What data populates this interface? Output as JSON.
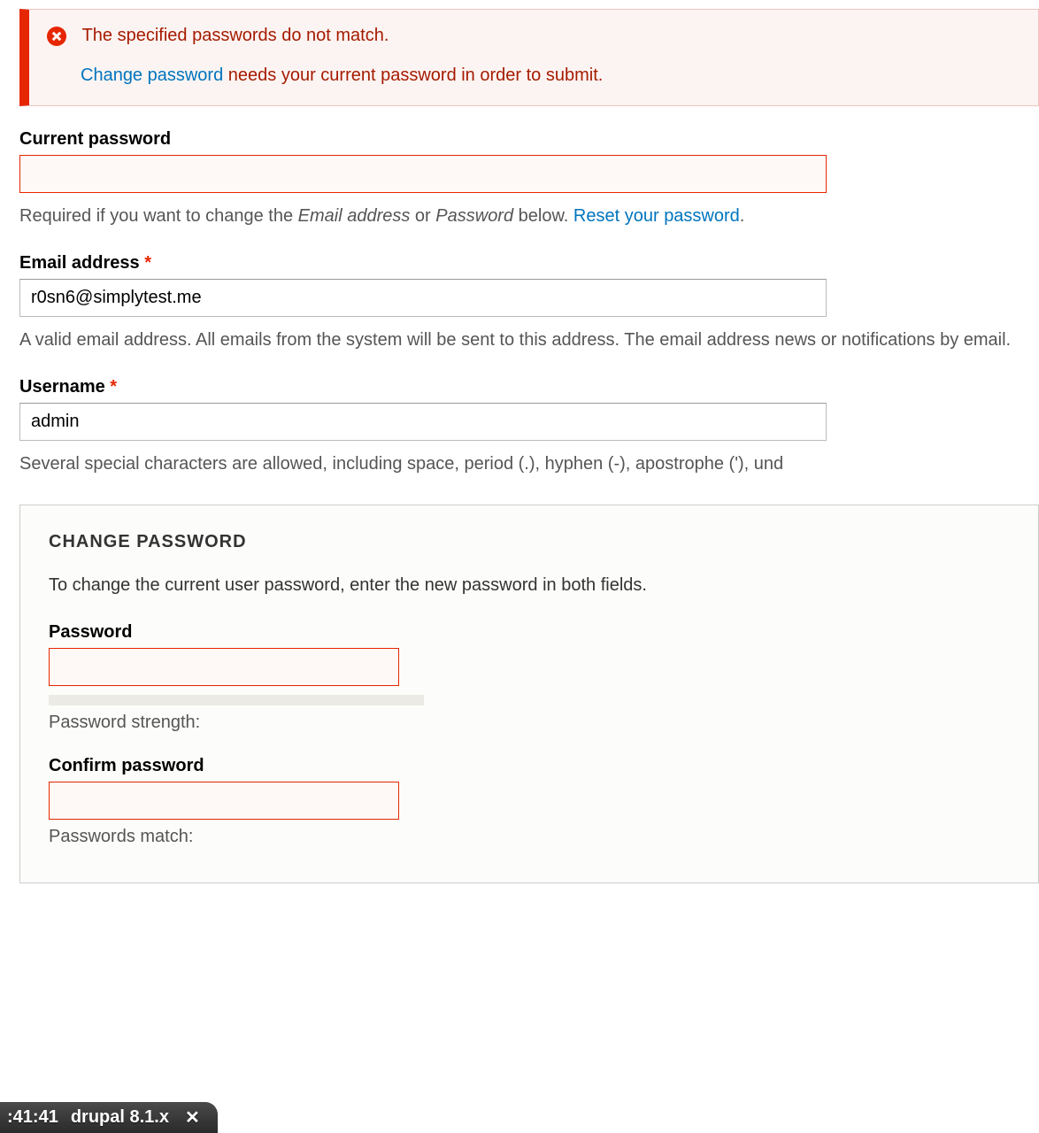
{
  "error": {
    "line1": "The specified passwords do not match.",
    "line2_link": "Change password",
    "line2_rest": " needs your current password in order to submit."
  },
  "form": {
    "current_password": {
      "label": "Current password",
      "value": "",
      "description_pre": "Required if you want to change the ",
      "em1": "Email address",
      "or": " or ",
      "em2": "Password",
      "description_post": " below. ",
      "reset_link": "Reset your password",
      "period": "."
    },
    "email": {
      "label": "Email address",
      "value": "r0sn6@simplytest.me",
      "description": "A valid email address. All emails from the system will be sent to this address. The email address news or notifications by email."
    },
    "username": {
      "label": "Username",
      "value": "admin",
      "description": "Several special characters are allowed, including space, period (.), hyphen (-), apostrophe ('), und"
    }
  },
  "change_password": {
    "legend": "CHANGE PASSWORD",
    "intro": "To change the current user password, enter the new password in both fields.",
    "password_label": "Password",
    "strength_label": "Password strength:",
    "confirm_label": "Confirm password",
    "match_label": "Passwords match:"
  },
  "taskbar": {
    "time": ":41:41",
    "title": "drupal 8.1.x"
  }
}
